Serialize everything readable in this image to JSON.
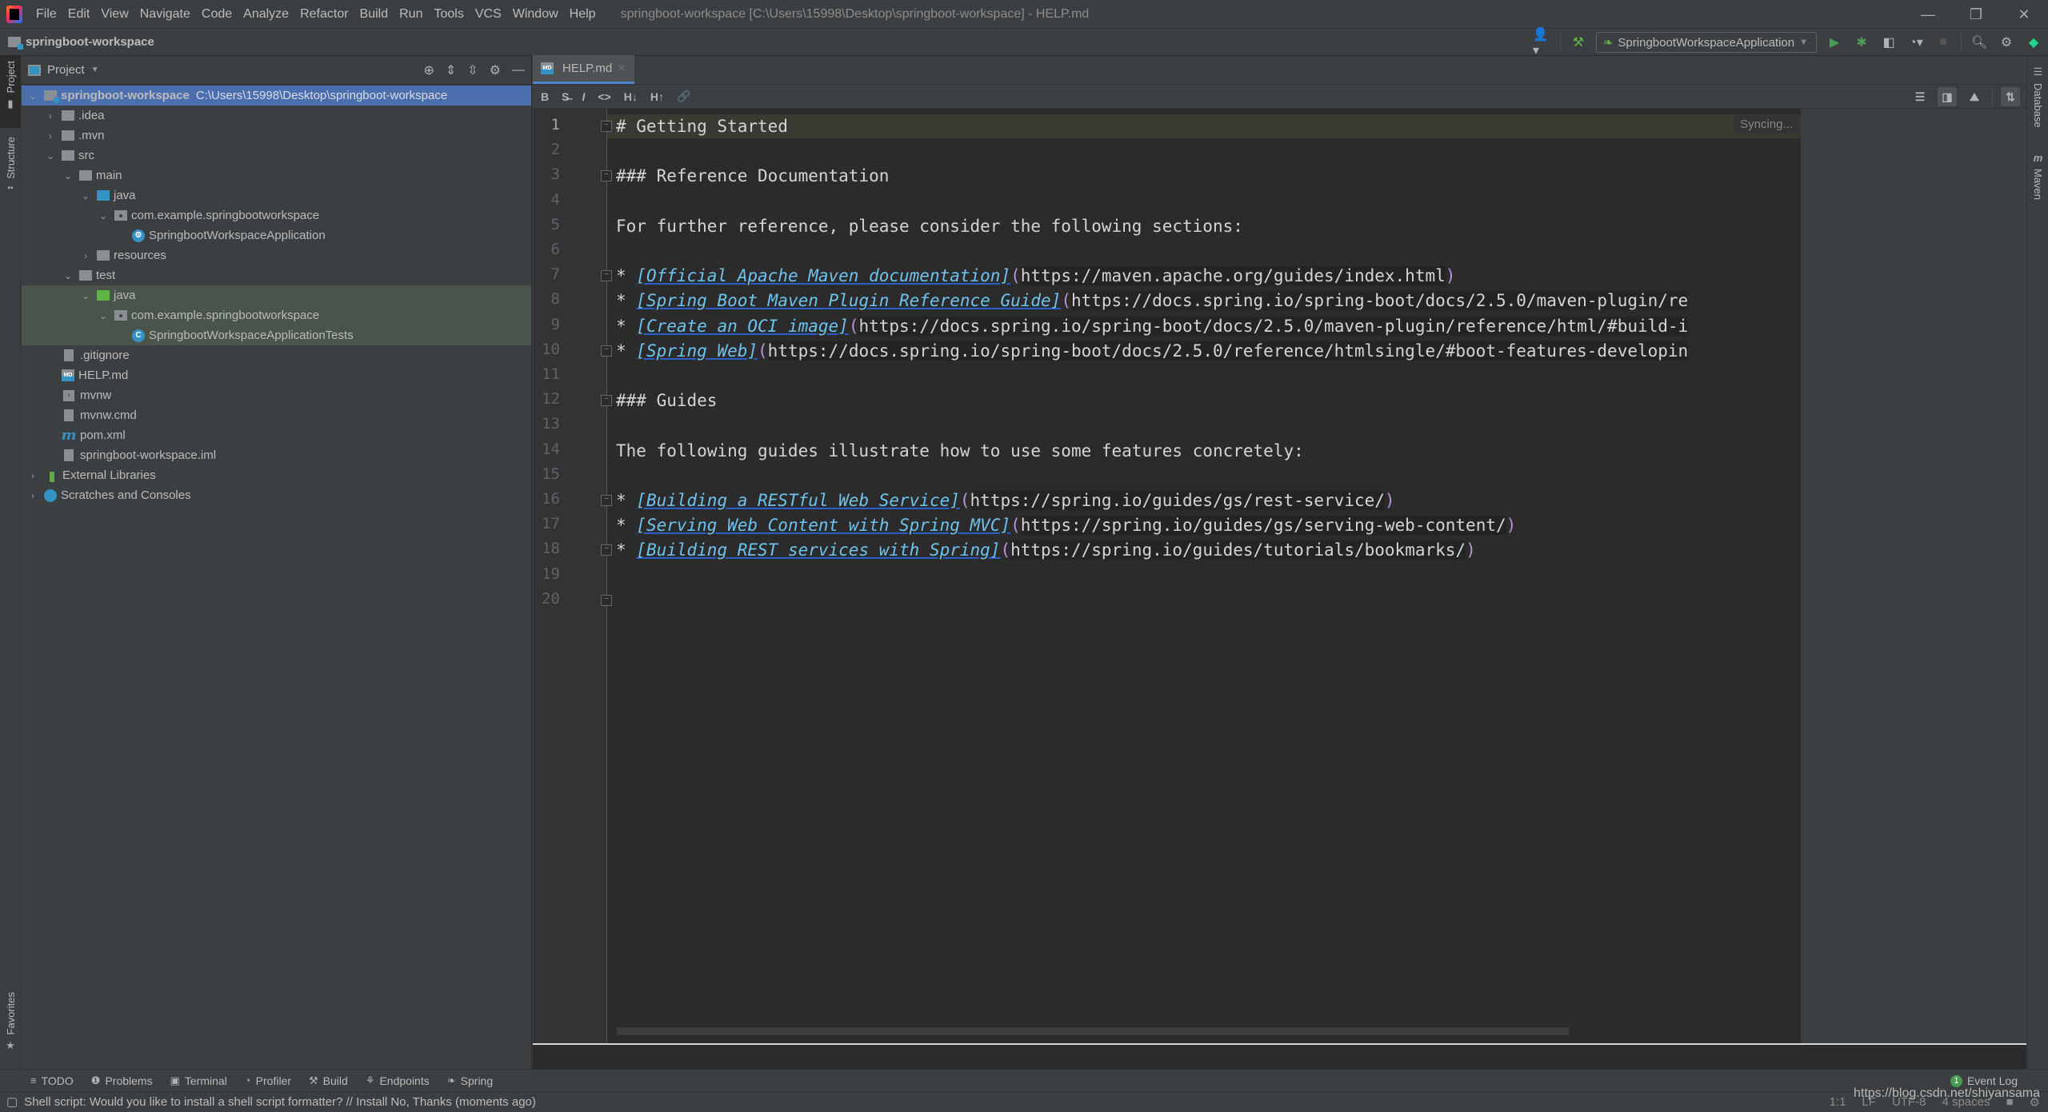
{
  "window": {
    "title": "springboot-workspace [C:\\Users\\15998\\Desktop\\springboot-workspace] - HELP.md",
    "controls": {
      "minimize": "—",
      "restore": "❐",
      "close": "✕"
    }
  },
  "menu": [
    "File",
    "Edit",
    "View",
    "Navigate",
    "Code",
    "Analyze",
    "Refactor",
    "Build",
    "Run",
    "Tools",
    "VCS",
    "Window",
    "Help"
  ],
  "navbar": {
    "breadcrumb": "springboot-workspace",
    "run_config": "SpringbootWorkspaceApplication",
    "icons": [
      "user-icon",
      "hammer-icon",
      "run-icon",
      "debug-icon",
      "coverage-icon",
      "profile-icon",
      "stop-icon",
      "search-icon",
      "settings-icon",
      "toolbox-icon"
    ]
  },
  "left_stripe": {
    "project": "Project",
    "structure": "Structure",
    "favorites": "Favorites"
  },
  "right_stripe": {
    "database": "Database",
    "maven": "Maven"
  },
  "project_panel": {
    "title": "Project",
    "tree": [
      {
        "label": "springboot-workspace",
        "hint": "C:\\Users\\15998\\Desktop\\springboot-workspace",
        "depth": 0,
        "expanded": true,
        "icon": "module-folder",
        "selected": true
      },
      {
        "label": ".idea",
        "depth": 1,
        "expanded": false,
        "icon": "folder"
      },
      {
        "label": ".mvn",
        "depth": 1,
        "expanded": false,
        "icon": "folder"
      },
      {
        "label": "src",
        "depth": 1,
        "expanded": true,
        "icon": "folder"
      },
      {
        "label": "main",
        "depth": 2,
        "expanded": true,
        "icon": "folder"
      },
      {
        "label": "java",
        "depth": 3,
        "expanded": true,
        "icon": "source-folder"
      },
      {
        "label": "com.example.springbootworkspace",
        "depth": 4,
        "expanded": true,
        "icon": "package"
      },
      {
        "label": "SpringbootWorkspaceApplication",
        "depth": 5,
        "icon": "spring-class"
      },
      {
        "label": "resources",
        "depth": 3,
        "expanded": false,
        "icon": "resources-folder"
      },
      {
        "label": "test",
        "depth": 2,
        "expanded": true,
        "icon": "folder"
      },
      {
        "label": "java",
        "depth": 3,
        "expanded": true,
        "icon": "test-folder",
        "test": true
      },
      {
        "label": "com.example.springbootworkspace",
        "depth": 4,
        "expanded": true,
        "icon": "package",
        "test": true
      },
      {
        "label": "SpringbootWorkspaceApplicationTests",
        "depth": 5,
        "icon": "test-class",
        "test": true
      },
      {
        "label": ".gitignore",
        "depth": 1,
        "icon": "gitignore-file"
      },
      {
        "label": "HELP.md",
        "depth": 1,
        "icon": "markdown-file"
      },
      {
        "label": "mvnw",
        "depth": 1,
        "icon": "shell-file"
      },
      {
        "label": "mvnw.cmd",
        "depth": 1,
        "icon": "text-file"
      },
      {
        "label": "pom.xml",
        "depth": 1,
        "icon": "maven-file"
      },
      {
        "label": "springboot-workspace.iml",
        "depth": 1,
        "icon": "iml-file"
      },
      {
        "label": "External Libraries",
        "depth": 0,
        "expanded": false,
        "icon": "libraries"
      },
      {
        "label": "Scratches and Consoles",
        "depth": 0,
        "expanded": false,
        "icon": "scratches"
      }
    ]
  },
  "editor": {
    "tab": "HELP.md",
    "md_toolbar": [
      "B",
      "S̶",
      "I",
      "<>",
      "H↓",
      "H↑",
      "🔗"
    ],
    "syncing": "Syncing...",
    "lines": [
      {
        "n": 1,
        "parts": [
          {
            "t": "# Getting Started",
            "k": "plain"
          }
        ]
      },
      {
        "n": 2,
        "parts": []
      },
      {
        "n": 3,
        "parts": [
          {
            "t": "### Reference Documentation",
            "k": "plain"
          }
        ]
      },
      {
        "n": 4,
        "parts": []
      },
      {
        "n": 5,
        "parts": [
          {
            "t": "For further reference, please consider the following sections:",
            "k": "plain"
          }
        ]
      },
      {
        "n": 6,
        "parts": []
      },
      {
        "n": 7,
        "parts": [
          {
            "t": "* ",
            "k": "plain"
          },
          {
            "t": "[Official Apache Maven documentation]",
            "k": "link"
          },
          {
            "t": "(",
            "k": "paren"
          },
          {
            "t": "https://maven.apache.org/guides/index.html",
            "k": "url"
          },
          {
            "t": ")",
            "k": "paren"
          }
        ]
      },
      {
        "n": 8,
        "parts": [
          {
            "t": "* ",
            "k": "plain"
          },
          {
            "t": "[Spring Boot Maven Plugin Reference Guide]",
            "k": "link"
          },
          {
            "t": "(",
            "k": "paren"
          },
          {
            "t": "https://docs.spring.io/spring-boot/docs/2.5.0/maven-plugin/re",
            "k": "url"
          }
        ]
      },
      {
        "n": 9,
        "parts": [
          {
            "t": "* ",
            "k": "plain"
          },
          {
            "t": "[Create an OCI image]",
            "k": "link"
          },
          {
            "t": "(",
            "k": "paren"
          },
          {
            "t": "https://docs.spring.io/spring-boot/docs/2.5.0/maven-plugin/reference/html/#build-i",
            "k": "url"
          }
        ]
      },
      {
        "n": 10,
        "parts": [
          {
            "t": "* ",
            "k": "plain"
          },
          {
            "t": "[Spring Web]",
            "k": "link"
          },
          {
            "t": "(",
            "k": "paren"
          },
          {
            "t": "https://docs.spring.io/spring-boot/docs/2.5.0/reference/htmlsingle/#boot-features-developin",
            "k": "url"
          }
        ]
      },
      {
        "n": 11,
        "parts": []
      },
      {
        "n": 12,
        "parts": [
          {
            "t": "### Guides",
            "k": "plain"
          }
        ]
      },
      {
        "n": 13,
        "parts": []
      },
      {
        "n": 14,
        "parts": [
          {
            "t": "The following guides illustrate how to use some features concretely:",
            "k": "plain"
          }
        ]
      },
      {
        "n": 15,
        "parts": []
      },
      {
        "n": 16,
        "parts": [
          {
            "t": "* ",
            "k": "plain"
          },
          {
            "t": "[Building a RESTful Web Service]",
            "k": "link"
          },
          {
            "t": "(",
            "k": "paren"
          },
          {
            "t": "https://spring.io/guides/gs/rest-service/",
            "k": "url"
          },
          {
            "t": ")",
            "k": "paren"
          }
        ]
      },
      {
        "n": 17,
        "parts": [
          {
            "t": "* ",
            "k": "plain"
          },
          {
            "t": "[Serving Web Content with Spring MVC]",
            "k": "link"
          },
          {
            "t": "(",
            "k": "paren"
          },
          {
            "t": "https://spring.io/guides/gs/serving-web-content/",
            "k": "url"
          },
          {
            "t": ")",
            "k": "paren"
          }
        ]
      },
      {
        "n": 18,
        "parts": [
          {
            "t": "* ",
            "k": "plain"
          },
          {
            "t": "[Building REST services with Spring]",
            "k": "link"
          },
          {
            "t": "(",
            "k": "paren"
          },
          {
            "t": "https://spring.io/guides/tutorials/bookmarks/",
            "k": "url"
          },
          {
            "t": ")",
            "k": "paren"
          }
        ]
      },
      {
        "n": 19,
        "parts": []
      },
      {
        "n": 20,
        "parts": []
      }
    ],
    "fold_lines": [
      1,
      3,
      7,
      10,
      12,
      16,
      18,
      20
    ]
  },
  "bottom_tools": [
    {
      "label": "TODO",
      "icon": "≡"
    },
    {
      "label": "Problems",
      "icon": "❶"
    },
    {
      "label": "Terminal",
      "icon": "▣"
    },
    {
      "label": "Profiler",
      "icon": "◔"
    },
    {
      "label": "Build",
      "icon": "⚒"
    },
    {
      "label": "Endpoints",
      "icon": "⚘"
    },
    {
      "label": "Spring",
      "icon": "❧"
    }
  ],
  "event_log": {
    "count": "1",
    "label": "Event Log"
  },
  "status": {
    "message": "Shell script: Would you like to install a shell script formatter? // Install   No, Thanks (moments ago)",
    "position": "1:1",
    "line_sep": "LF",
    "encoding": "UTF-8",
    "indent": "4 spaces"
  },
  "watermark": "https://blog.csdn.net/shiyansama"
}
